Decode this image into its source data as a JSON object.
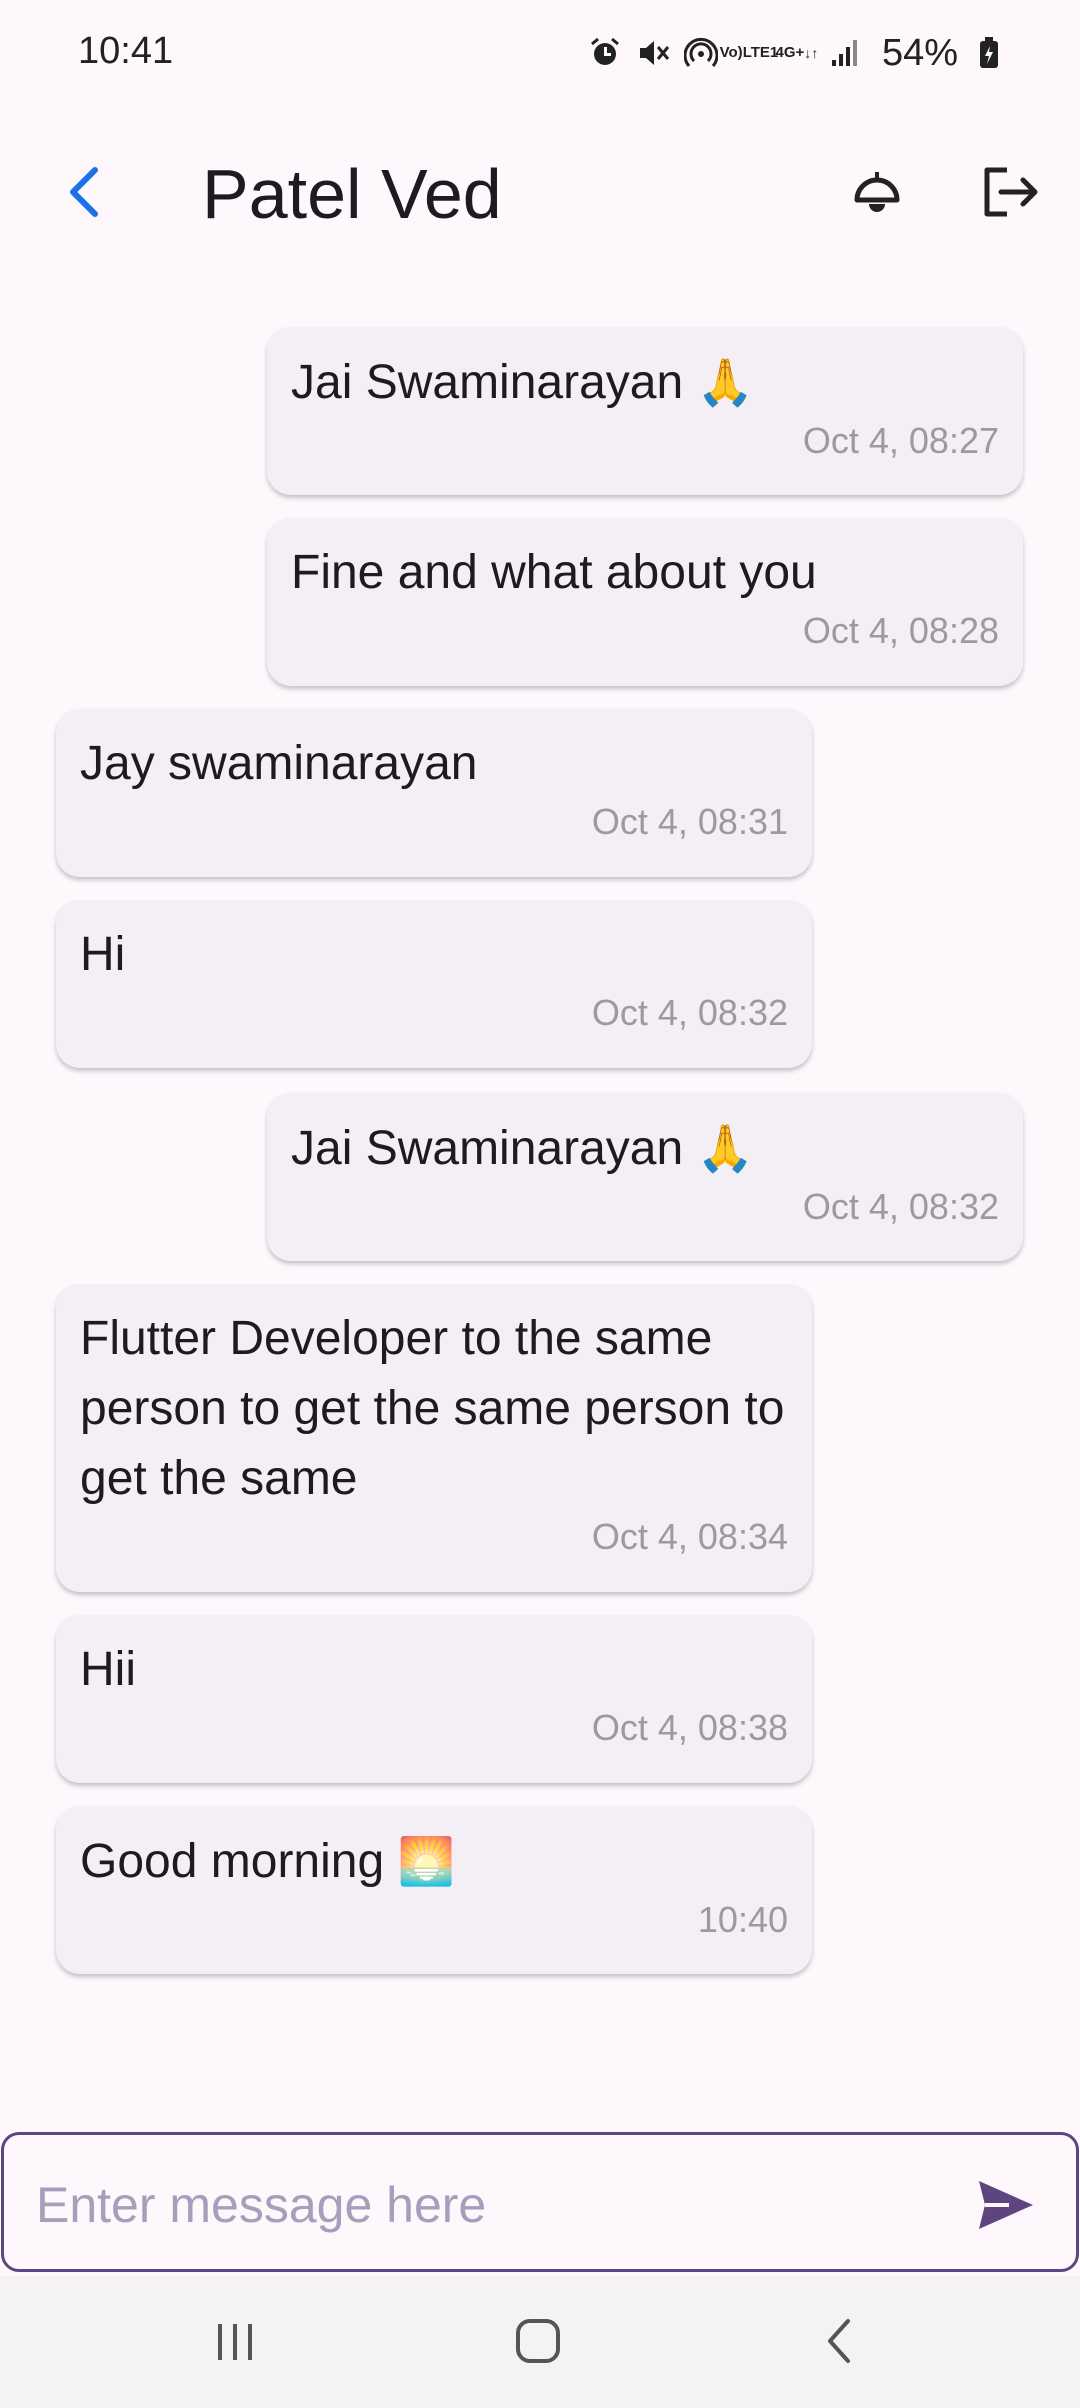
{
  "status_bar": {
    "time": "10:41",
    "volte_top": "Vo)",
    "volte_bottom": "LTE1",
    "network": "4G+",
    "battery": "54%",
    "icons": [
      "alarm-icon",
      "mute-icon",
      "hotspot-icon",
      "volte-icon",
      "network-4g-icon",
      "signal-icon",
      "battery-icon"
    ]
  },
  "app_bar": {
    "title": "Patel Ved",
    "icons": [
      "back-arrow-icon",
      "notification-bell-icon",
      "logout-icon"
    ],
    "accent_color": "#1a73e8"
  },
  "messages": [
    {
      "side": "sent",
      "text": "Jai Swaminarayan",
      "emoji": "🙏",
      "time": "Oct 4, 08:27"
    },
    {
      "side": "sent",
      "text": "Fine and what about you",
      "emoji": "",
      "time": "Oct 4, 08:28"
    },
    {
      "side": "received",
      "text": "Jay swaminarayan",
      "emoji": "",
      "time": "Oct 4, 08:31"
    },
    {
      "side": "received",
      "text": "Hi",
      "emoji": "",
      "time": "Oct 4, 08:32"
    },
    {
      "side": "sent",
      "text": "Jai Swaminarayan",
      "emoji": "🙏",
      "time": "Oct 4, 08:32"
    },
    {
      "side": "received",
      "text": "Flutter Developer to the same person to get the same person to get the same",
      "emoji": "",
      "time": "Oct 4, 08:34"
    },
    {
      "side": "received",
      "text": "Hii",
      "emoji": "",
      "time": "Oct 4, 08:38"
    },
    {
      "side": "received",
      "text": "Good morning",
      "emoji": "🌅",
      "time": "10:40"
    }
  ],
  "composer": {
    "placeholder": "Enter message here",
    "value": "",
    "border_color": "#5d467f",
    "send_icon": "send-icon"
  },
  "nav_bar": {
    "icons": [
      "recent-apps-icon",
      "home-icon",
      "back-icon"
    ]
  }
}
